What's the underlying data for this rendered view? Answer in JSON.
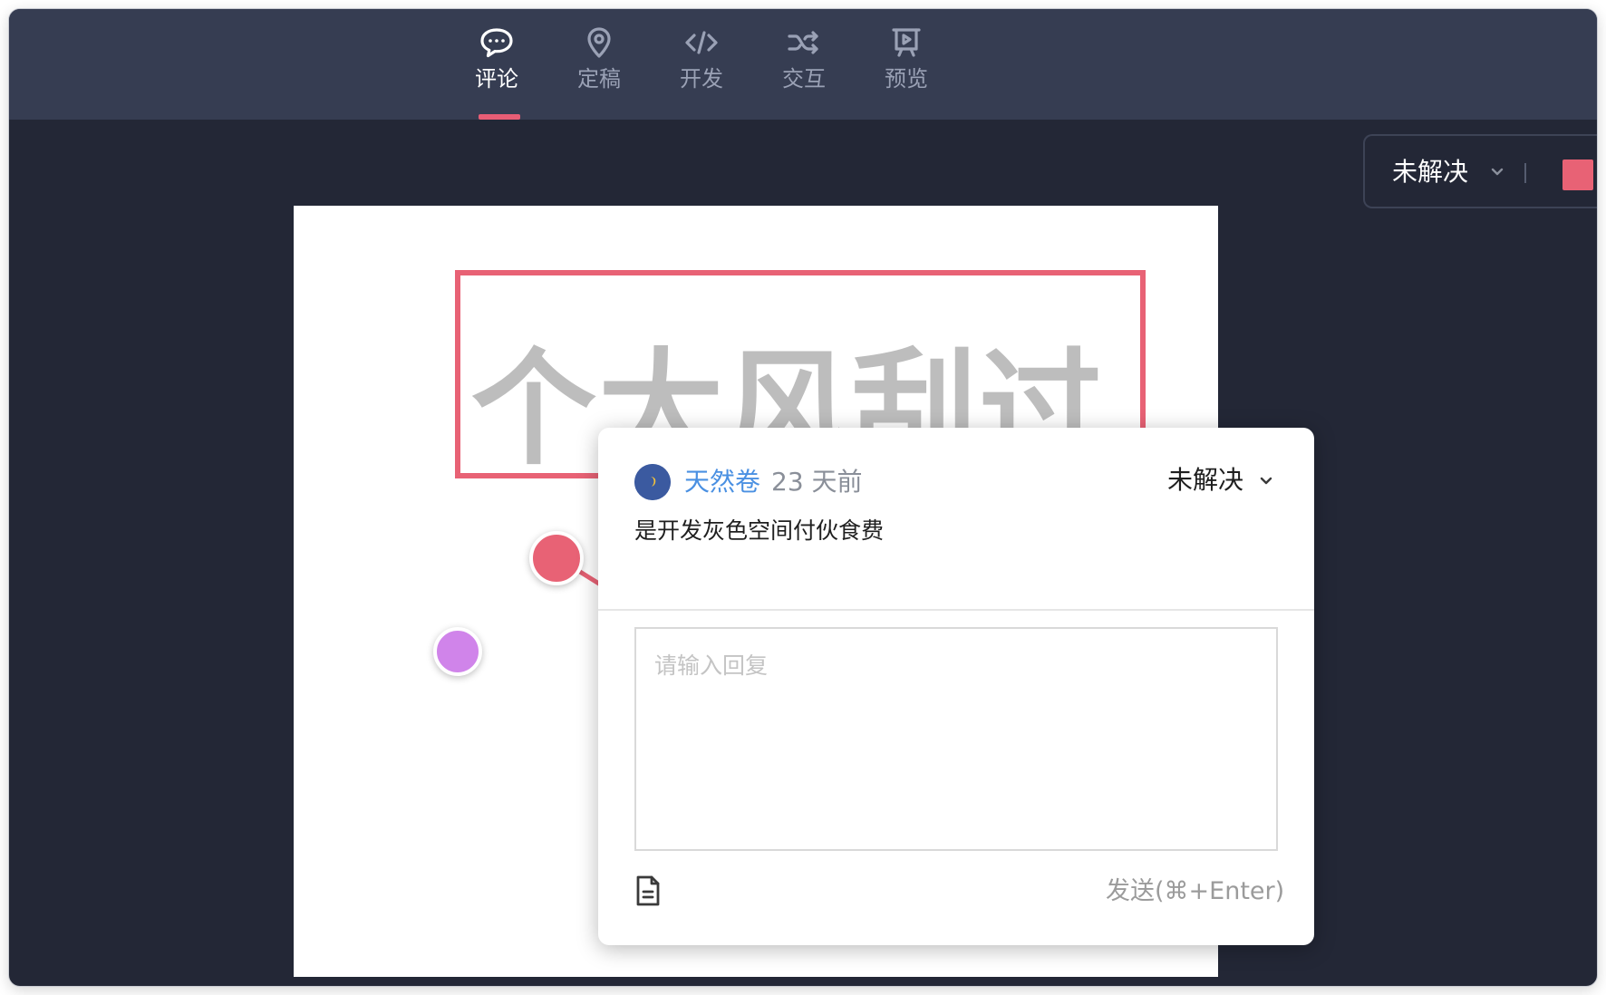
{
  "nav": {
    "items": [
      {
        "label": "评论",
        "icon": "comment-icon",
        "active": true
      },
      {
        "label": "定稿",
        "icon": "location-pin-icon",
        "active": false
      },
      {
        "label": "开发",
        "icon": "code-icon",
        "active": false
      },
      {
        "label": "交互",
        "icon": "shuffle-icon",
        "active": false
      },
      {
        "label": "预览",
        "icon": "presentation-icon",
        "active": false
      }
    ]
  },
  "filter": {
    "status": "未解决",
    "swatch_color": "#e86275"
  },
  "artboard": {
    "design_text": "个大风刮过"
  },
  "pins": [
    {
      "color": "#e86275",
      "icon": "comment-pin"
    },
    {
      "color": "#d084ea",
      "icon": "comment-pin"
    }
  ],
  "popup": {
    "author": "天然卷",
    "time": "23 天前",
    "status": "未解决",
    "comment": "是开发灰色空间付伙食费",
    "reply_placeholder": "请输入回复",
    "send_label": "发送(⌘+Enter)"
  },
  "colors": {
    "accent": "#e85d75",
    "topbar": "#363d52",
    "background": "#232736",
    "link": "#4a90e2"
  }
}
